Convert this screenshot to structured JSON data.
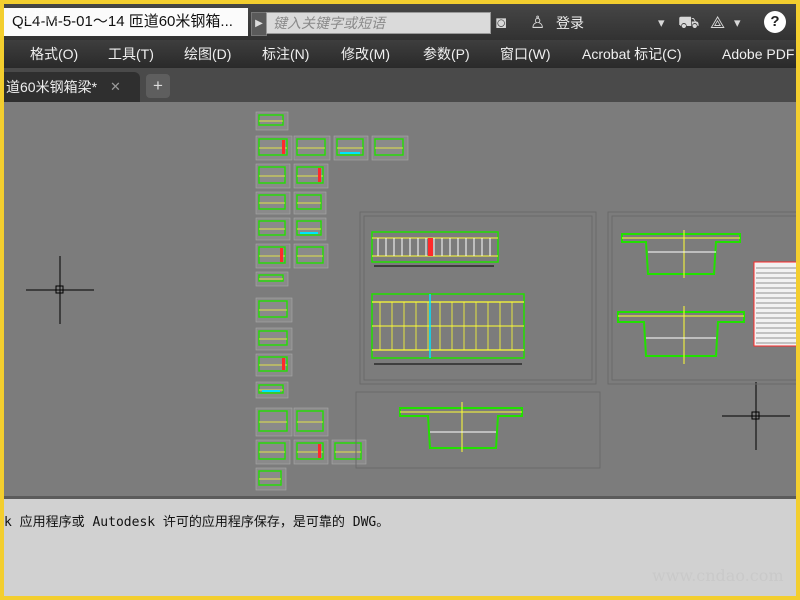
{
  "titlebar": {
    "doc_title": "QL4-M-5-01～14 匝道60米钢箱...",
    "search_placeholder": "键入关键字或短语",
    "search_arrow": "▶",
    "binoculars_icon": "◙",
    "user_icon": "♙",
    "login_label": "登录",
    "dropdown_arrow": "▾",
    "cart_icon": "⛟",
    "exchange_icon": "⟁",
    "help_label": "?"
  },
  "menu": {
    "items": [
      "格式(O)",
      "工具(T)",
      "绘图(D)",
      "标注(N)",
      "修改(M)",
      "参数(P)",
      "窗口(W)",
      "Acrobat 标记(C)",
      "Adobe PDF"
    ]
  },
  "tabs": {
    "active_label": "道60米钢箱梁*",
    "close_symbol": "✕",
    "add_symbol": "+"
  },
  "commandline": {
    "text": "k 应用程序或 Autodesk 许可的应用程序保存，是可靠的 DWG。"
  },
  "watermark": {
    "site": "www.cndao.com",
    "corner": "笔杆网"
  },
  "colors": {
    "frame_border": "#f3ce2e",
    "canvas_bg": "#7c7c7c",
    "drawing_green": "#22e000",
    "drawing_yellow": "#ffff33",
    "drawing_red": "#ff2a2a",
    "drawing_cyan": "#00e5ff"
  }
}
